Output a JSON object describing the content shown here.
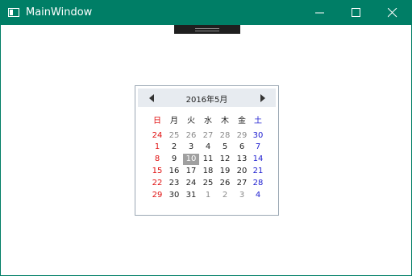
{
  "window": {
    "title": "MainWindow"
  },
  "calendar": {
    "month_label": "2016年5月",
    "weekday_headers": [
      "日",
      "月",
      "火",
      "水",
      "木",
      "金",
      "土"
    ],
    "weeks": [
      [
        "24",
        "25",
        "26",
        "27",
        "28",
        "29",
        "30"
      ],
      [
        "1",
        "2",
        "3",
        "4",
        "5",
        "6",
        "7"
      ],
      [
        "8",
        "9",
        "10",
        "11",
        "12",
        "13",
        "14"
      ],
      [
        "15",
        "16",
        "17",
        "18",
        "19",
        "20",
        "21"
      ],
      [
        "22",
        "23",
        "24",
        "25",
        "26",
        "27",
        "28"
      ],
      [
        "29",
        "30",
        "31",
        "1",
        "2",
        "3",
        "4"
      ]
    ],
    "selected_day": "10",
    "colors": {
      "sunday": "#e01010",
      "saturday": "#2020d0",
      "other_month": "#8a8a8a",
      "selected_bg": "#a0a0a0",
      "accent": "#007e66"
    }
  }
}
